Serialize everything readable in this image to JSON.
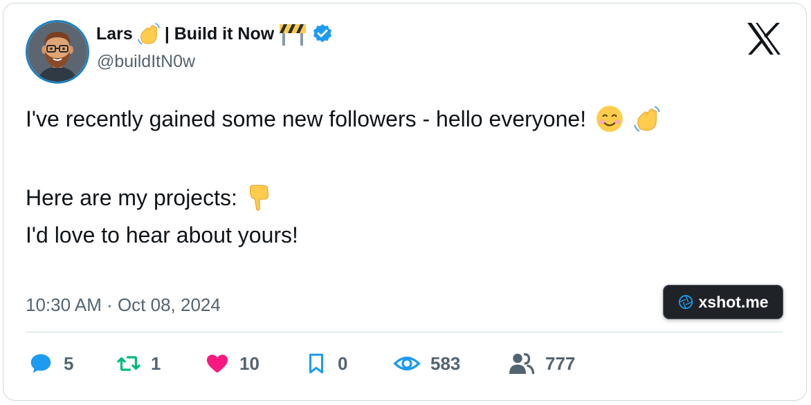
{
  "tweet": {
    "display_name": "Lars",
    "name_suffix": "| Build it Now",
    "handle": "@buildItN0w",
    "verified": true,
    "lines": [
      "I've recently gained some new followers - hello everyone!",
      "Here are my projects:",
      "I'd love to hear about yours!"
    ],
    "timestamp": "10:30 AM · Oct 08, 2024"
  },
  "icons": {
    "name_emoji_1": "waving-hand-icon",
    "name_emoji_2": "construction-barrier-icon",
    "badge": "verified-badge-icon",
    "brand": "x-logo-icon",
    "line1_emojis": [
      "smiling-face-icon",
      "waving-hand-icon"
    ],
    "line2_emoji": "pointing-down-icon"
  },
  "stats": {
    "replies": "5",
    "retweets": "1",
    "likes": "10",
    "bookmarks": "0",
    "views": "583",
    "followers": "777"
  },
  "watermark": {
    "label": "xshot.me"
  },
  "colors": {
    "reply": "#1d9bf0",
    "retweet": "#00ba7c",
    "like": "#f91880",
    "bookmark": "#1d9bf0",
    "views": "#1d9bf0",
    "followers": "#536471",
    "verified": "#1d9bf0",
    "secondary_text": "#536471"
  }
}
